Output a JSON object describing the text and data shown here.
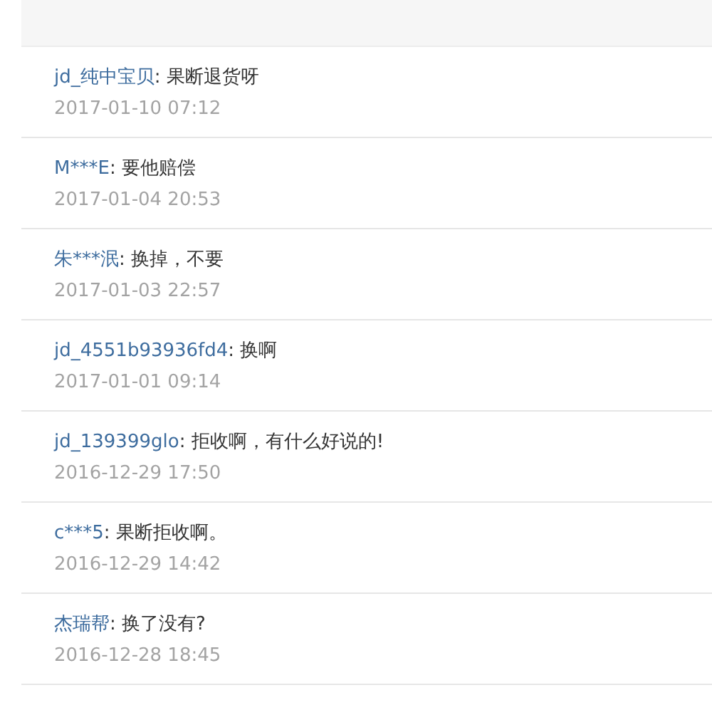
{
  "comments": [
    {
      "user": "jd_纯中宝贝",
      "text": ": 果断退货呀",
      "time": "2017-01-10 07:12"
    },
    {
      "user": "M***E",
      "text": ": 要他赔偿",
      "time": "2017-01-04 20:53"
    },
    {
      "user": "朱***泯",
      "text": ": 换掉，不要",
      "time": "2017-01-03 22:57"
    },
    {
      "user": "jd_4551b93936fd4",
      "text": ": 换啊",
      "time": "2017-01-01 09:14"
    },
    {
      "user": "jd_139399glo",
      "text": ": 拒收啊，有什么好说的!",
      "time": "2016-12-29 17:50"
    },
    {
      "user": "c***5",
      "text": ": 果断拒收啊。",
      "time": "2016-12-29 14:42"
    },
    {
      "user": "杰瑞帮",
      "text": ": 换了没有?",
      "time": "2016-12-28 18:45"
    }
  ]
}
